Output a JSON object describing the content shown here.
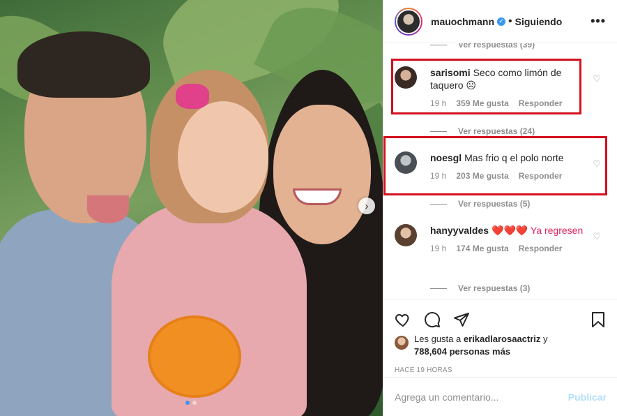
{
  "header": {
    "username": "mauochmann",
    "separator": "•",
    "follow_status": "Siguiendo",
    "more": "•••"
  },
  "comments": {
    "top_view_replies": "Ver respuestas (39)",
    "items": [
      {
        "username": "sarisomi",
        "text": "Seco como limón de taquero ☹",
        "time": "19 h",
        "likes": "359 Me gusta",
        "reply": "Responder",
        "view_replies": "Ver respuestas (24)",
        "highlighted": true
      },
      {
        "username": "noesgl",
        "text": "Mas frio q el polo norte",
        "time": "19 h",
        "likes": "203 Me gusta",
        "reply": "Responder",
        "view_replies": "Ver respuestas (5)",
        "highlighted": true
      },
      {
        "username": "hanyyvaldes",
        "text": "❤️❤️❤️ Ya regresen",
        "time": "19 h",
        "likes": "174 Me gusta",
        "reply": "Responder",
        "view_replies": "Ver respuestas (3)",
        "highlighted": false
      }
    ]
  },
  "likes": {
    "prefix": "Les gusta a",
    "user": "erikadlarosaactriz",
    "joiner": "y",
    "others": "788,604 personas más"
  },
  "time_ago": "HACE 19 HORAS",
  "add_comment": {
    "placeholder": "Agrega un comentario...",
    "publish_label": "Publicar"
  },
  "colors": {
    "highlight_border": "#d40f1e",
    "link_blue": "#3897f0",
    "publish_disabled": "#b2dffc",
    "muted": "#8e8e8e"
  },
  "icons": [
    "heart-icon",
    "comment-icon",
    "share-icon",
    "bookmark-icon",
    "more-icon",
    "verified-badge-icon",
    "chevron-right-icon"
  ],
  "carousel": {
    "total_slides": 2,
    "active_slide": 1
  }
}
